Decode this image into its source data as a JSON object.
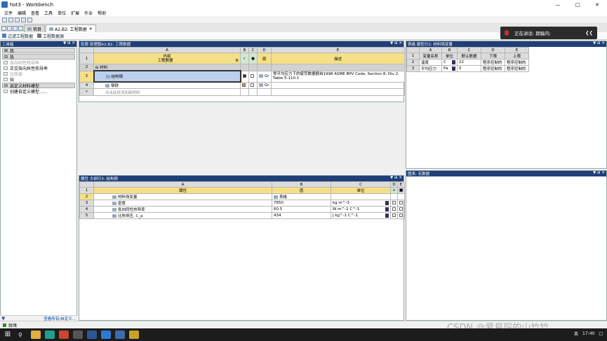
{
  "window": {
    "title": "hot3 - Workbench"
  },
  "menu": [
    "文件",
    "编辑",
    "查看",
    "工具",
    "单位",
    "扩展",
    "作业",
    "帮助"
  ],
  "tabs": [
    {
      "label": "项目"
    },
    {
      "label": "A2,B2: 工程数据"
    }
  ],
  "filters": {
    "filter1": "过滤工程数据",
    "filter2": "工程数据源"
  },
  "toolbox": {
    "title": "工具箱",
    "categories": [
      {
        "label": "热"
      },
      {
        "label": "热"
      }
    ],
    "items_thermal": [
      {
        "label": "各向同性热导率"
      },
      {
        "label": "正交各向异性热导率"
      },
      {
        "label": "比热容"
      },
      {
        "label": "焓"
      }
    ],
    "custom_category": "自定义材料模型",
    "custom_item": "创建自定义模型......",
    "footer_link": "查看所有/自定义..."
  },
  "outline": {
    "title": "轮廓 原理图A2,B2: 工程数据",
    "col_letters": [
      "A",
      "B",
      "C",
      "D",
      "E"
    ],
    "header": {
      "rownum": "1",
      "a": "内容\n工程数据",
      "d": "源",
      "e": "描述"
    },
    "rows": [
      {
        "rownum": "2",
        "a": "材料",
        "b": "",
        "c": "",
        "d": "",
        "e": ""
      },
      {
        "rownum": "3",
        "a": "结构钢",
        "d": "Gr",
        "e": "零平均应力下的疲劳数据摘自1998 ASME BPV Code, Section 8, Div 2, Table 5-110.1"
      },
      {
        "rownum": "4",
        "a": "钢铁",
        "d": "Gr",
        "e": ""
      },
      {
        "rownum": "*",
        "a": "点击此处添加新材料",
        "d": "",
        "e": ""
      }
    ]
  },
  "properties": {
    "title": "属性 大纲行3: 结构钢",
    "col_letters": [
      "A",
      "B",
      "C",
      "D",
      "E"
    ],
    "header": {
      "rownum": "1",
      "a": "属性",
      "b": "值",
      "c": "单位"
    },
    "rows": [
      {
        "rownum": "2",
        "a": "材料场变量",
        "b": "表格",
        "c": ""
      },
      {
        "rownum": "3",
        "a": "密度",
        "b": "7850",
        "c": "kg m^-3"
      },
      {
        "rownum": "4",
        "a": "各向同性热导率",
        "b": "60.5",
        "c": "W m^-1 C^-1"
      },
      {
        "rownum": "5",
        "a": "比热恒压, C_p",
        "b": "434",
        "c": "J kg^-1 C^-1"
      }
    ]
  },
  "tabular": {
    "title": "表格 属性行2: 材料场变量",
    "col_letters": [
      "A",
      "B",
      "C",
      "D",
      "E"
    ],
    "header": {
      "rownum": "1",
      "a": "变量名称",
      "b": "单位",
      "c": "默认数据",
      "d": "下限",
      "e": "上限"
    },
    "rows": [
      {
        "rownum": "2",
        "a": "温度",
        "b": "C",
        "c": "22",
        "d": "程序控制的",
        "e": "程序控制的"
      },
      {
        "rownum": "3",
        "a": "平均应力",
        "b": "Pa",
        "c": "0",
        "d": "程序控制的",
        "e": "程序控制的"
      }
    ]
  },
  "chart": {
    "title": "图表: 无数据"
  },
  "chat": {
    "text": "正在讲话: 期稿内;"
  },
  "status": {
    "text": "就绪"
  },
  "taskbar": {
    "ime": "英",
    "time": "17:40"
  },
  "watermark": "CSDN @爱易琛的山竹竹"
}
